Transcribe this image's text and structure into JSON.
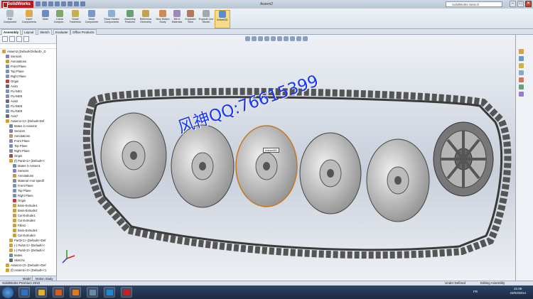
{
  "app": {
    "brand": "SolidWorks",
    "doc_title": "Assem2",
    "search_placeholder": "SolidWorks Search",
    "win_min": "–",
    "win_max": "□",
    "win_close": "✕"
  },
  "ribbon": [
    {
      "label": "Edit Component",
      "color": "#b0b8c4"
    },
    {
      "label": "Insert Components",
      "color": "#e0a84a"
    },
    {
      "label": "Mate",
      "color": "#6c8cc8"
    },
    {
      "label": "Linear Compon...",
      "color": "#7ca86a"
    },
    {
      "label": "Smart Fasteners",
      "color": "#c8b04a"
    },
    {
      "label": "Move Component",
      "color": "#7a98c8"
    },
    {
      "label": "Show Hidden Components",
      "color": "#8ab0d8"
    },
    {
      "label": "Assembly Features",
      "color": "#6aa070"
    },
    {
      "label": "Reference Geometry",
      "color": "#c6a050"
    },
    {
      "label": "New Motion Study",
      "color": "#d08a5a"
    },
    {
      "label": "Bill of Materials",
      "color": "#9a8ab8"
    },
    {
      "label": "Exploded View",
      "color": "#b07a5a"
    },
    {
      "label": "Explode Line Sketch",
      "color": "#a0a8b4"
    },
    {
      "label": "Instant3D",
      "color": "#5a8ad0"
    }
  ],
  "tabs": [
    "Assembly",
    "Layout",
    "Sketch",
    "Evaluate",
    "Office Products"
  ],
  "tree": [
    {
      "label": "Assem2 (Default<Default>_D",
      "depth": 0,
      "color": "#d4a030"
    },
    {
      "label": "Sensors",
      "depth": 1,
      "color": "#8a7ac0"
    },
    {
      "label": "Annotations",
      "depth": 1,
      "color": "#c89a40"
    },
    {
      "label": "Front Plane",
      "depth": 1,
      "color": "#7a90b8"
    },
    {
      "label": "Top Plane",
      "depth": 1,
      "color": "#7a90b8"
    },
    {
      "label": "Right Plane",
      "depth": 1,
      "color": "#7a90b8"
    },
    {
      "label": "Origin",
      "depth": 1,
      "color": "#c04040"
    },
    {
      "label": "Axis1",
      "depth": 1,
      "color": "#6a6a6a"
    },
    {
      "label": "PLANE1",
      "depth": 1,
      "color": "#7a90b8"
    },
    {
      "label": "PLANE6",
      "depth": 1,
      "color": "#7a90b8"
    },
    {
      "label": "Axis2",
      "depth": 1,
      "color": "#6a6a6a"
    },
    {
      "label": "PLANE8",
      "depth": 1,
      "color": "#7a90b8"
    },
    {
      "label": "PLANE9",
      "depth": 1,
      "color": "#7a90b8"
    },
    {
      "label": "Axis7",
      "depth": 1,
      "color": "#6a6a6a"
    },
    {
      "label": "Assem1<1> (Default<Def",
      "depth": 1,
      "color": "#d4a030"
    },
    {
      "label": "Mates in Assem2",
      "depth": 2,
      "color": "#6a8ab8"
    },
    {
      "label": "Sensors",
      "depth": 2,
      "color": "#8a7ac0"
    },
    {
      "label": "Annotations",
      "depth": 2,
      "color": "#c89a40"
    },
    {
      "label": "Front Plane",
      "depth": 2,
      "color": "#7a90b8"
    },
    {
      "label": "Top Plane",
      "depth": 2,
      "color": "#7a90b8"
    },
    {
      "label": "Right Plane",
      "depth": 2,
      "color": "#7a90b8"
    },
    {
      "label": "Origin",
      "depth": 2,
      "color": "#c04040"
    },
    {
      "label": "(f) Part2<1> (Default<<",
      "depth": 2,
      "color": "#d4a030"
    },
    {
      "label": "Mates in Assem1",
      "depth": 3,
      "color": "#6a8ab8"
    },
    {
      "label": "Sensors",
      "depth": 3,
      "color": "#8a7ac0"
    },
    {
      "label": "Annotations",
      "depth": 3,
      "color": "#c89a40"
    },
    {
      "label": "Material <not specifi",
      "depth": 3,
      "color": "#8a8a8a"
    },
    {
      "label": "Front Plane",
      "depth": 3,
      "color": "#7a90b8"
    },
    {
      "label": "Top Plane",
      "depth": 3,
      "color": "#7a90b8"
    },
    {
      "label": "Right Plane",
      "depth": 3,
      "color": "#7a90b8"
    },
    {
      "label": "Origin",
      "depth": 3,
      "color": "#c04040"
    },
    {
      "label": "Boss-Extrude1",
      "depth": 3,
      "color": "#c8a040"
    },
    {
      "label": "Boss-Extrude2",
      "depth": 3,
      "color": "#c8a040"
    },
    {
      "label": "Cut-Extrude1",
      "depth": 3,
      "color": "#c8a040"
    },
    {
      "label": "Cut-Extrude2",
      "depth": 3,
      "color": "#c8a040"
    },
    {
      "label": "Fillet1",
      "depth": 3,
      "color": "#c8a040"
    },
    {
      "label": "Boss-Extrude3",
      "depth": 3,
      "color": "#c8a040"
    },
    {
      "label": "Cut-Extrude3",
      "depth": 3,
      "color": "#c8a040"
    },
    {
      "label": "Part3<1> (Default<<Def",
      "depth": 2,
      "color": "#d4a030"
    },
    {
      "label": "(-) Part4<1> (Default<<",
      "depth": 2,
      "color": "#d4a030"
    },
    {
      "label": "(-) Part4<2> (Default<<",
      "depth": 2,
      "color": "#d4a030"
    },
    {
      "label": "Mates",
      "depth": 2,
      "color": "#6a8ab8"
    },
    {
      "label": "Sketch1",
      "depth": 2,
      "color": "#6a6a6a"
    },
    {
      "label": "Assem1<2> (Default<<Def",
      "depth": 1,
      "color": "#d4a030"
    },
    {
      "label": "(f) Assem1<2> (Default<<1",
      "depth": 1,
      "color": "#d4a030"
    }
  ],
  "bottom_tabs": [
    "Model",
    "Motion Study 1"
  ],
  "tooltip": "Instant3D",
  "watermark": "风神QQ:76615399",
  "status": {
    "left": "SolidWorks Premium 2010",
    "mid": "Under Defined",
    "right": "Editing Assembly"
  },
  "taskbar": {
    "apps": [
      "#2a74c8",
      "#e0b030",
      "#d85a20",
      "#e07a20",
      "#6a8aa8",
      "#1a8ad8",
      "#c82020"
    ],
    "lang": "FR",
    "time": "21:09",
    "date": "23/02/2014"
  }
}
